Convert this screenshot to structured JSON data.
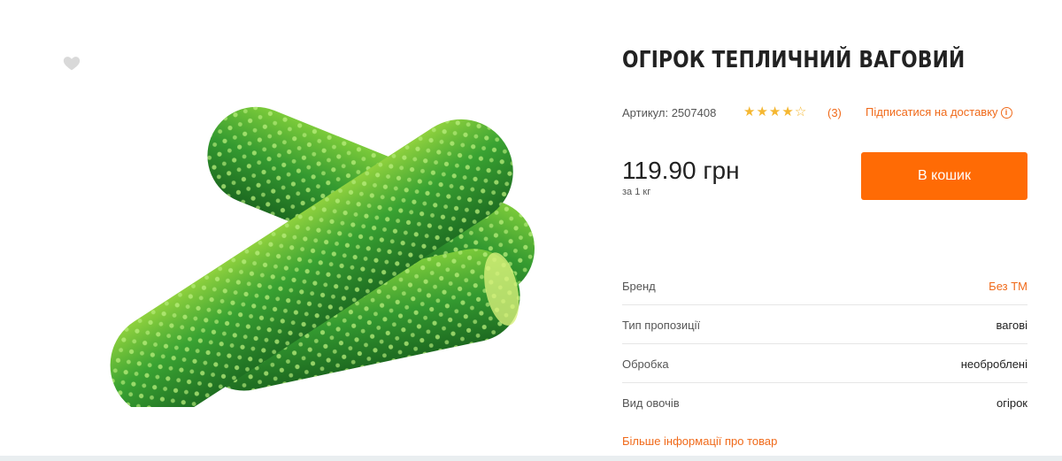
{
  "product": {
    "title": "ОГІРОК ТЕПЛИЧНИЙ ВАГОВИЙ",
    "image_alt": "cucumbers",
    "sku_label": "Артикул:",
    "sku_value": "2507408",
    "rating": 4,
    "rating_max": 5,
    "reviews_count": "(3)",
    "subscribe_label": "Підписатися на доставку",
    "price": "119.90 грн",
    "price_unit": "за 1 кг",
    "cart_button": "В кошик",
    "favorite_icon": "heart-icon",
    "info_icon": "info-icon"
  },
  "properties": [
    {
      "key": "Бренд",
      "value": "Без ТМ"
    },
    {
      "key": "Тип пропозиції",
      "value": "вагові"
    },
    {
      "key": "Обробка",
      "value": "необроблені"
    },
    {
      "key": "Вид овочів",
      "value": "огірок"
    }
  ],
  "more_link": "Більше інформації про товар",
  "colors": {
    "accent": "#ff6b05",
    "link": "#f06a1a",
    "star": "#f5b731",
    "cucumber_dark": "#2e8a2a",
    "cucumber_light": "#a6dc4a"
  }
}
